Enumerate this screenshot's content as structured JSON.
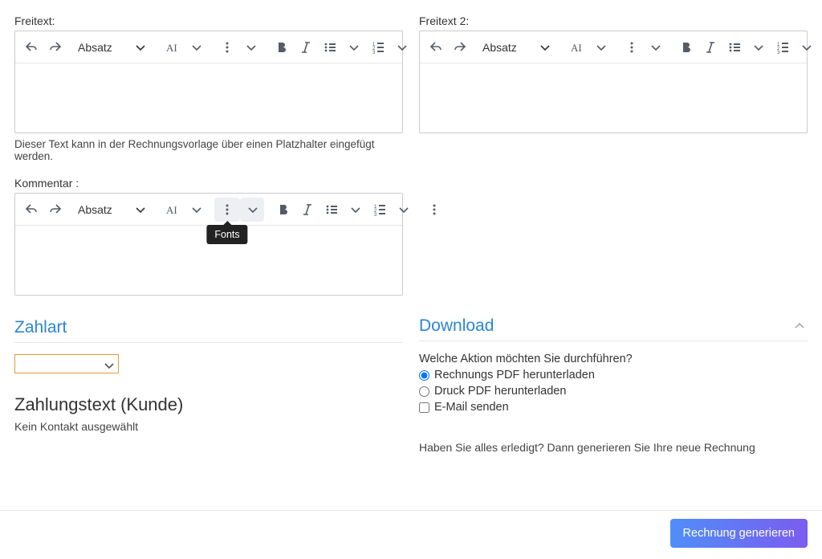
{
  "editors": {
    "freitext1": {
      "label": "Freitext:",
      "paragraph": "Absatz",
      "helper": "Dieser Text kann in der Rechnungsvorlage über einen Platzhalter eingefügt werden."
    },
    "freitext2": {
      "label": "Freitext 2:",
      "paragraph": "Absatz"
    },
    "kommentar": {
      "label": "Kommentar :",
      "paragraph": "Absatz",
      "tooltip": "Fonts"
    }
  },
  "zahlart": {
    "title": "Zahlart",
    "selected": ""
  },
  "zahlungstext": {
    "title": "Zahlungstext (Kunde)",
    "note": "Kein Kontakt ausgewählt"
  },
  "download": {
    "title": "Download",
    "question": "Welche Aktion möchten Sie durchführen?",
    "opt_invoice_pdf": "Rechnungs PDF herunterladen",
    "opt_print_pdf": "Druck PDF herunterladen",
    "opt_email": "E-Mail senden",
    "hint": "Haben Sie alles erledigt? Dann generieren Sie Ihre neue Rechnung"
  },
  "footer": {
    "generate": "Rechnung generieren"
  }
}
